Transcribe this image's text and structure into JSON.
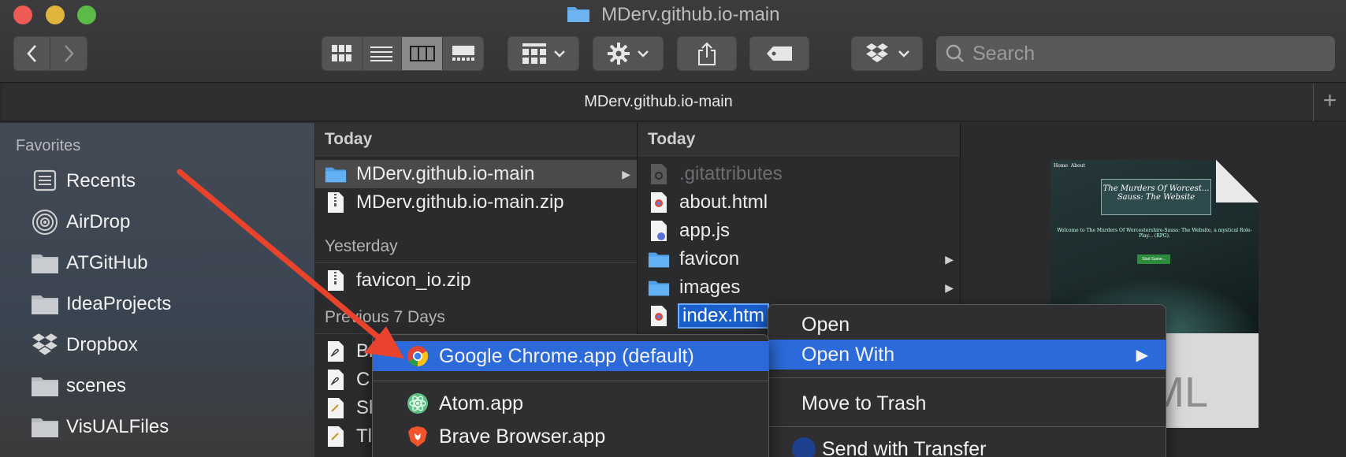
{
  "window": {
    "title": "MDerv.github.io-main"
  },
  "toolbar": {
    "search_placeholder": "Search"
  },
  "pathbar": {
    "title": "MDerv.github.io-main",
    "plus": "+"
  },
  "sidebar": {
    "heading": "Favorites",
    "items": [
      {
        "label": "Recents",
        "icon": "recents-icon"
      },
      {
        "label": "AirDrop",
        "icon": "airdrop-icon"
      },
      {
        "label": "ATGitHub",
        "icon": "folder-icon"
      },
      {
        "label": "IdeaProjects",
        "icon": "folder-icon"
      },
      {
        "label": "Dropbox",
        "icon": "dropbox-icon"
      },
      {
        "label": "scenes",
        "icon": "folder-icon"
      },
      {
        "label": "VisUALFiles",
        "icon": "folder-icon"
      }
    ]
  },
  "column1": {
    "sections": [
      {
        "heading": "Today"
      },
      {
        "heading": "Yesterday"
      },
      {
        "heading": "Previous 7 Days"
      }
    ],
    "rows": [
      {
        "label": "MDerv.github.io-main"
      },
      {
        "label": "MDerv.github.io-main.zip"
      },
      {
        "label": "favicon_io.zip"
      },
      {
        "label": "Br"
      },
      {
        "label": "C"
      },
      {
        "label": "Sl"
      },
      {
        "label": "Tl"
      }
    ]
  },
  "column2": {
    "heading": "Today",
    "rows": [
      {
        "label": ".gitattributes"
      },
      {
        "label": "about.html"
      },
      {
        "label": "app.js"
      },
      {
        "label": "favicon"
      },
      {
        "label": "images"
      },
      {
        "label": "index.htm"
      }
    ]
  },
  "preview": {
    "nav": [
      "Home",
      "About"
    ],
    "heading": "The Murders Of Worcest... Sauss: The Website",
    "intro": "Welcome to The Murders Of Worcestershire-Sauss: The Website, a mystical Role-Play... (RPG).",
    "button": "Start Game...",
    "type_label": "ML"
  },
  "context_menu": {
    "items": [
      "Open",
      "Open With",
      "Move to Trash",
      "Send with Transfer"
    ],
    "arrow": "▶"
  },
  "submenu": {
    "items": [
      "Google Chrome.app (default)",
      "Atom.app",
      "Brave Browser.app"
    ]
  },
  "colors": {
    "accent": "#2b6ad8",
    "annotation_arrow": "#e8432c"
  }
}
